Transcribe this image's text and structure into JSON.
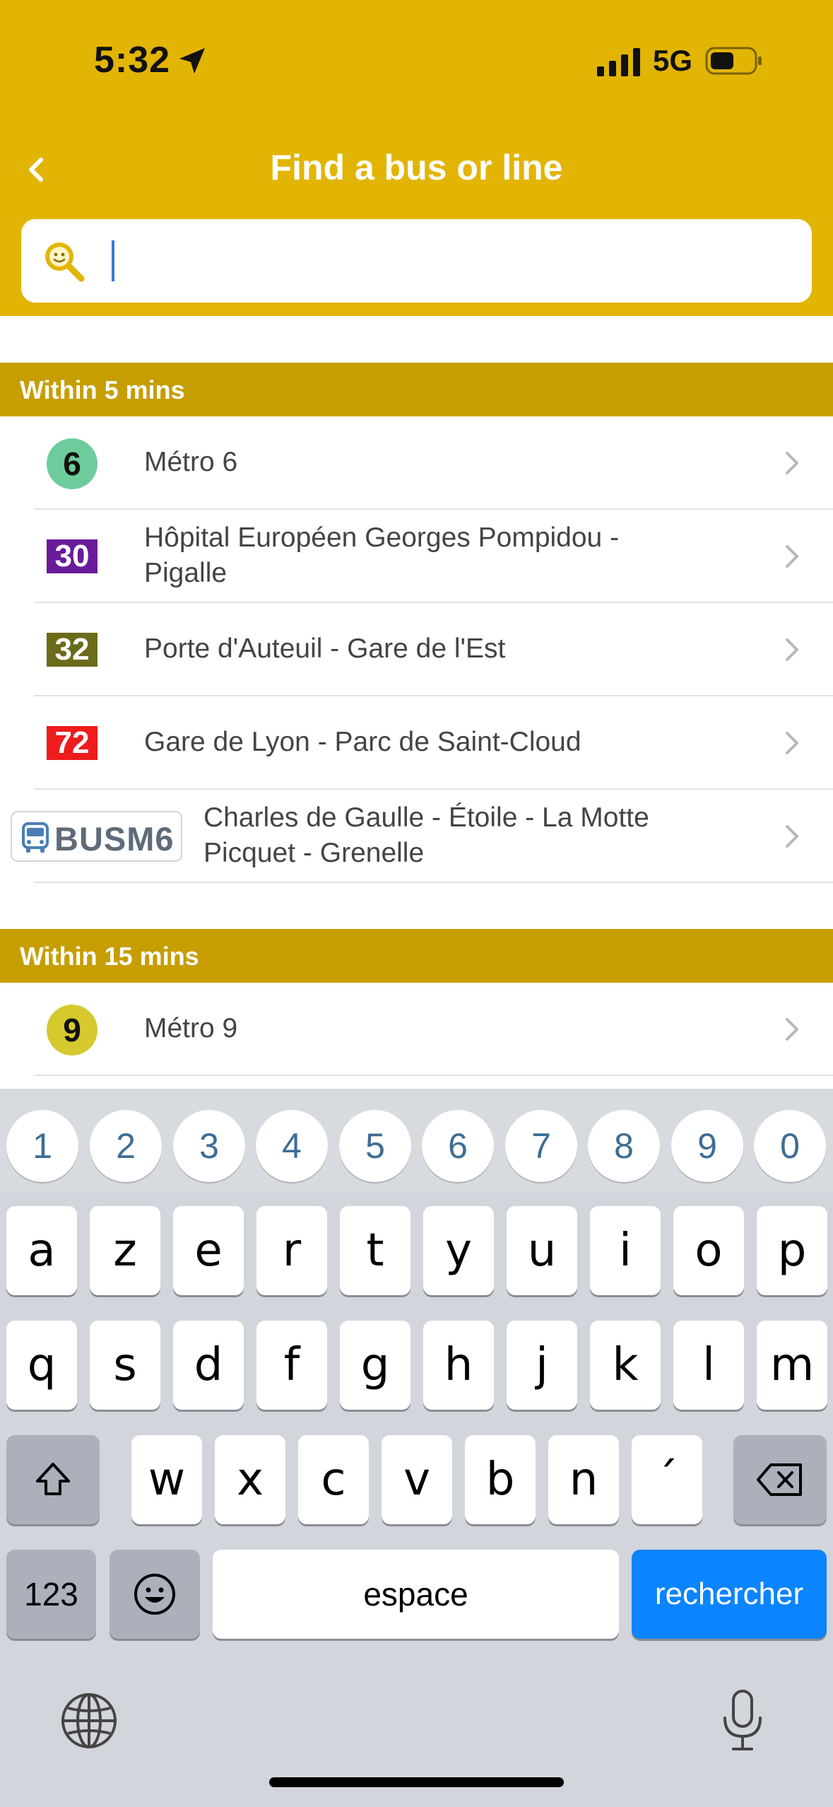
{
  "status_bar": {
    "time": "5:32",
    "network": "5G"
  },
  "header": {
    "title": "Find a bus or line"
  },
  "search": {
    "value": "",
    "placeholder": ""
  },
  "sections": [
    {
      "title": "Within 5 mins",
      "rows": [
        {
          "badge": "6",
          "badge_type": "metro",
          "badge_color": "#6ecb9b",
          "label": "Métro 6"
        },
        {
          "badge": "30",
          "badge_type": "bus",
          "badge_color": "#6a1b9a",
          "label": "Hôpital Européen Georges Pompidou - Pigalle"
        },
        {
          "badge": "32",
          "badge_type": "bus",
          "badge_color": "#6b6b1a",
          "label": "Porte d'Auteuil - Gare de l'Est"
        },
        {
          "badge": "72",
          "badge_type": "bus",
          "badge_color": "#ee1c1c",
          "label": "Gare de Lyon - Parc de Saint-Cloud"
        },
        {
          "badge": "BUSM6",
          "badge_type": "busm",
          "badge_color": "#5e6b78",
          "label": "Charles de Gaulle - Étoile - La Motte Picquet - Grenelle"
        }
      ]
    },
    {
      "title": "Within 15 mins",
      "rows": [
        {
          "badge": "9",
          "badge_type": "metro",
          "badge_color": "#d5c92e",
          "label": "Métro 9"
        }
      ]
    }
  ],
  "keyboard": {
    "numbers": [
      "1",
      "2",
      "3",
      "4",
      "5",
      "6",
      "7",
      "8",
      "9",
      "0"
    ],
    "row1": [
      "a",
      "z",
      "e",
      "r",
      "t",
      "y",
      "u",
      "i",
      "o",
      "p"
    ],
    "row2": [
      "q",
      "s",
      "d",
      "f",
      "g",
      "h",
      "j",
      "k",
      "l",
      "m"
    ],
    "row3": [
      "w",
      "x",
      "c",
      "v",
      "b",
      "n",
      "´"
    ],
    "mode_key": "123",
    "space_label": "espace",
    "return_label": "rechercher",
    "icons": [
      "shift-icon",
      "backspace-icon",
      "emoji-icon",
      "globe-icon",
      "microphone-icon"
    ]
  },
  "colors": {
    "header": "#e2b504",
    "section": "#c69e00",
    "accent": "#0a84ff"
  }
}
